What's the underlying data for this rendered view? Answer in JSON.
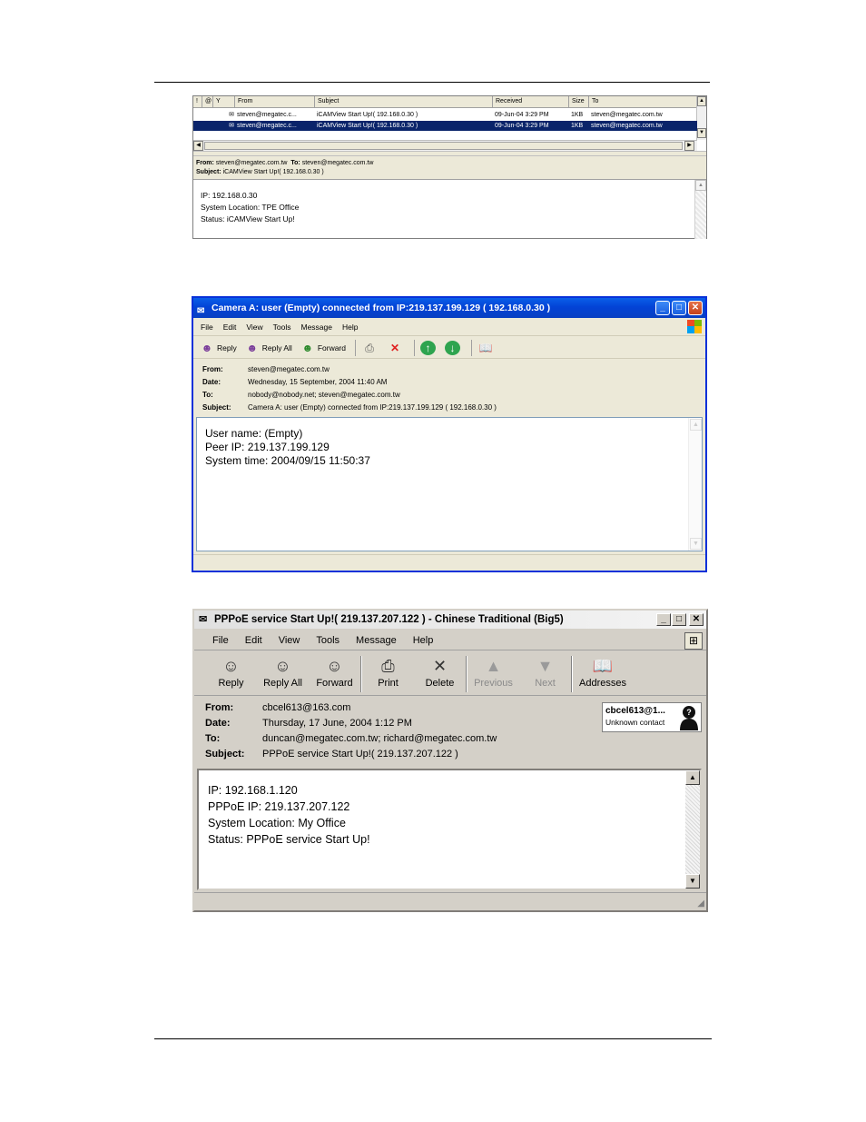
{
  "panel1": {
    "columns": [
      "!",
      "@",
      "Y",
      "From",
      "Subject",
      "Received",
      "Size",
      "To"
    ],
    "rows": [
      {
        "from": "steven@megatec.c...",
        "subject": "iCAMView Start Up!( 192.168.0.30 )",
        "received": "09-Jun-04 3:29 PM",
        "size": "1KB",
        "to": "steven@megatec.com.tw",
        "selected": false
      },
      {
        "from": "steven@megatec.c...",
        "subject": "iCAMView Start Up!( 192.168.0.30 )",
        "received": "09-Jun-04 3:29 PM",
        "size": "1KB",
        "to": "steven@megatec.com.tw",
        "selected": true
      }
    ],
    "preview": {
      "from_label": "From:",
      "from": "steven@megatec.com.tw",
      "to_label": "To:",
      "to": "steven@megatec.com.tw",
      "subject_label": "Subject:",
      "subject": "iCAMView Start Up!( 192.168.0.30 )",
      "body": [
        "IP: 192.168.0.30",
        "System Location: TPE Office",
        "Status: iCAMView Start Up!"
      ]
    }
  },
  "panel2": {
    "title": "Camera A: user (Empty) connected from IP:219.137.199.129 ( 192.168.0.30 )",
    "menu": [
      "File",
      "Edit",
      "View",
      "Tools",
      "Message",
      "Help"
    ],
    "toolbar": {
      "reply": "Reply",
      "reply_all": "Reply All",
      "forward": "Forward"
    },
    "headers": [
      {
        "label": "From:",
        "value": "steven@megatec.com.tw"
      },
      {
        "label": "Date:",
        "value": "Wednesday, 15 September, 2004 11:40 AM"
      },
      {
        "label": "To:",
        "value": "nobody@nobody.net; steven@megatec.com.tw"
      },
      {
        "label": "Subject:",
        "value": "Camera A: user (Empty) connected from IP:219.137.199.129 ( 192.168.0.30 )"
      }
    ],
    "body": [
      "User name: (Empty)",
      "Peer IP: 219.137.199.129",
      "System time: 2004/09/15 11:50:37"
    ]
  },
  "panel3": {
    "title": "PPPoE service Start Up!( 219.137.207.122 ) - Chinese Traditional (Big5)",
    "menu": [
      "File",
      "Edit",
      "View",
      "Tools",
      "Message",
      "Help"
    ],
    "toolbar": {
      "reply": "Reply",
      "reply_all": "Reply All",
      "forward": "Forward",
      "print": "Print",
      "delete": "Delete",
      "previous": "Previous",
      "next": "Next",
      "addresses": "Addresses"
    },
    "headers": [
      {
        "label": "From:",
        "value": "cbcel613@163.com"
      },
      {
        "label": "Date:",
        "value": "Thursday, 17 June, 2004 1:12 PM"
      },
      {
        "label": "To:",
        "value": "duncan@megatec.com.tw; richard@megatec.com.tw"
      },
      {
        "label": "Subject:",
        "value": "PPPoE service Start Up!( 219.137.207.122 )"
      }
    ],
    "contact": {
      "name": "cbcel613@1...",
      "status": "Unknown contact"
    },
    "body": [
      "IP: 192.168.1.120",
      "PPPoE IP: 219.137.207.122",
      "System Location: My Office",
      "Status: PPPoE service Start Up!"
    ]
  }
}
